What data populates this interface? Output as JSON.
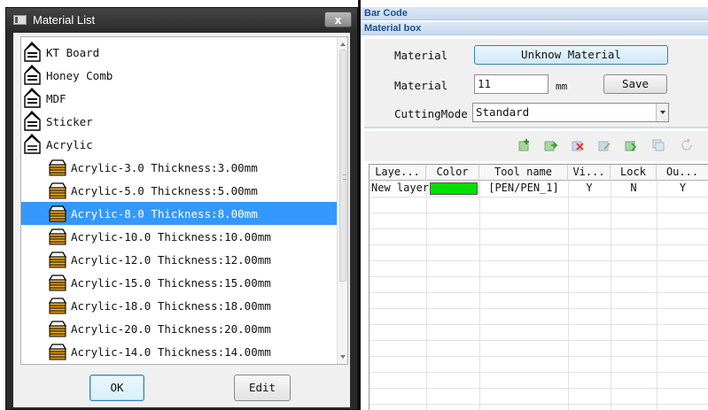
{
  "dialog": {
    "title": "Material List",
    "close_label": "x",
    "ok_label": "OK",
    "edit_label": "Edit",
    "categories": [
      "KT Board",
      "Honey Comb",
      "MDF",
      "Sticker",
      "Acrylic"
    ],
    "acrylic_items": [
      "Acrylic-3.0 Thickness:3.00mm",
      "Acrylic-5.0 Thickness:5.00mm",
      "Acrylic-8.0 Thickness:8.00mm",
      "Acrylic-10.0 Thickness:10.00mm",
      "Acrylic-12.0 Thickness:12.00mm",
      "Acrylic-15.0 Thickness:15.00mm",
      "Acrylic-18.0 Thickness:18.00mm",
      "Acrylic-20.0 Thickness:20.00mm",
      "Acrylic-14.0 Thickness:14.00mm"
    ],
    "selected_item": "Acrylic-8.0 Thickness:8.00mm"
  },
  "panel": {
    "bar_code_header": "Bar Code",
    "material_box_header": "Material box",
    "material_label": "Material",
    "material_button": "Unknow Material",
    "thickness_label": "Material",
    "thickness_value": "11",
    "thickness_unit": "mm",
    "save_label": "Save",
    "cutting_mode_label": "CuttingMode",
    "cutting_mode_value": "Standard"
  },
  "toolbar_icons": [
    "add-layer-icon",
    "insert-layer-icon",
    "delete-layer-icon",
    "move-up-icon",
    "move-down-icon",
    "copy-layer-icon",
    "refresh-icon"
  ],
  "layers": {
    "columns": [
      "Laye...",
      "Color",
      "Tool name",
      "Vi...",
      "Lock",
      "Ou..."
    ],
    "rows": [
      {
        "name": "New layer",
        "color": "#00e000",
        "tool": "[PEN/PEN_1]",
        "visible": "Y",
        "lock": "N",
        "output": "Y"
      }
    ]
  },
  "colors": {
    "selection": "#3399ff",
    "header_text": "#1f4f8f",
    "layer_color": "#00e000"
  }
}
